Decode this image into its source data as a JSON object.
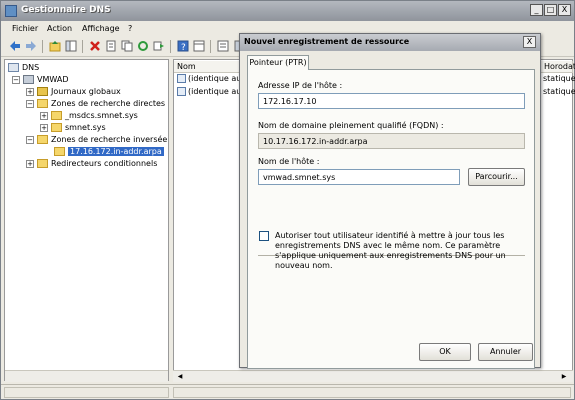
{
  "main_window": {
    "title": "Gestionnaire DNS",
    "controls": {
      "minimize": "_",
      "maximize": "□",
      "close": "X"
    },
    "menu": [
      "Fichier",
      "Action",
      "Affichage",
      "?"
    ]
  },
  "toolbar": {
    "icons": [
      "back-arrow-icon",
      "forward-arrow-icon",
      "folder-up-icon",
      "show-hide-tree-icon",
      "delete-icon",
      "properties-icon",
      "copy-icon",
      "refresh-icon",
      "export-icon",
      "help-icon",
      "panel-icon",
      "list-icon",
      "server-icon",
      "record-icon"
    ]
  },
  "tree": {
    "items": [
      {
        "label": "DNS",
        "expander": "",
        "level": 0
      },
      {
        "label": "VMWAD",
        "expander": "−",
        "level": 1
      },
      {
        "label": "Journaux globaux",
        "expander": "+",
        "level": 2
      },
      {
        "label": "Zones de recherche directes",
        "expander": "−",
        "level": 2
      },
      {
        "label": "_msdcs.smnet.sys",
        "expander": "+",
        "level": 3
      },
      {
        "label": "smnet.sys",
        "expander": "+",
        "level": 3
      },
      {
        "label": "Zones de recherche inversée",
        "expander": "−",
        "level": 2
      },
      {
        "label": "17.16.172.in-addr.arpa",
        "expander": "",
        "level": 3
      },
      {
        "label": "Redirecteurs conditionnels",
        "expander": "+",
        "level": 2
      }
    ]
  },
  "list": {
    "columns": [
      "Nom",
      "Horodat"
    ],
    "rows": [
      {
        "name": "(identique au d",
        "timestamp": "statique"
      },
      {
        "name": "(identique au d",
        "timestamp": "statique"
      }
    ]
  },
  "dialog": {
    "title": "Nouvel enregistrement de ressource",
    "close": "X",
    "tab": "Pointeur (PTR)",
    "host_ip_label": "Adresse IP de l'hôte :",
    "host_ip_value": "172.16.17.10",
    "fqdn_label": "Nom de domaine pleinement qualifié (FQDN) :",
    "fqdn_value": "10.17.16.172.in-addr.arpa",
    "hostname_label": "Nom de l'hôte :",
    "hostname_value": "vmwad.smnet.sys",
    "browse_button": "Parcourir...",
    "checkbox_text": "Autoriser tout utilisateur identifié à mettre à jour tous les enregistrements DNS avec le même nom. Ce paramètre s'applique uniquement aux enregistrements DNS pour un nouveau nom.",
    "checkbox_checked": false,
    "ok_button": "OK",
    "cancel_button": "Annuler"
  }
}
